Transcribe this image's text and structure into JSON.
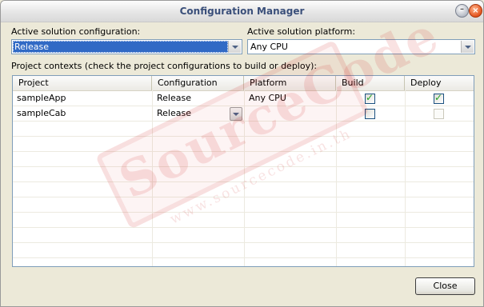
{
  "window": {
    "title": "Configuration Manager"
  },
  "title_buttons": {
    "minimize": "–",
    "close": "×"
  },
  "solution": {
    "config_label": "Active solution configuration:",
    "config_value": "Release",
    "platform_label": "Active solution platform:",
    "platform_value": "Any CPU"
  },
  "contexts_label": "Project contexts (check the project configurations to build or deploy):",
  "grid": {
    "columns": [
      "Project",
      "Configuration",
      "Platform",
      "Build",
      "Deploy"
    ],
    "rows": [
      {
        "project": "sampleApp",
        "configuration": "Release",
        "platform": "Any CPU",
        "build": true,
        "deploy": true,
        "deploy_enabled": true
      },
      {
        "project": "sampleCab",
        "configuration": "Release",
        "platform": "",
        "build": false,
        "deploy": false,
        "deploy_enabled": false
      }
    ]
  },
  "watermark": {
    "text": "SourceCode",
    "url": "www.sourcecode.in.th"
  },
  "buttons": {
    "close": "Close"
  }
}
